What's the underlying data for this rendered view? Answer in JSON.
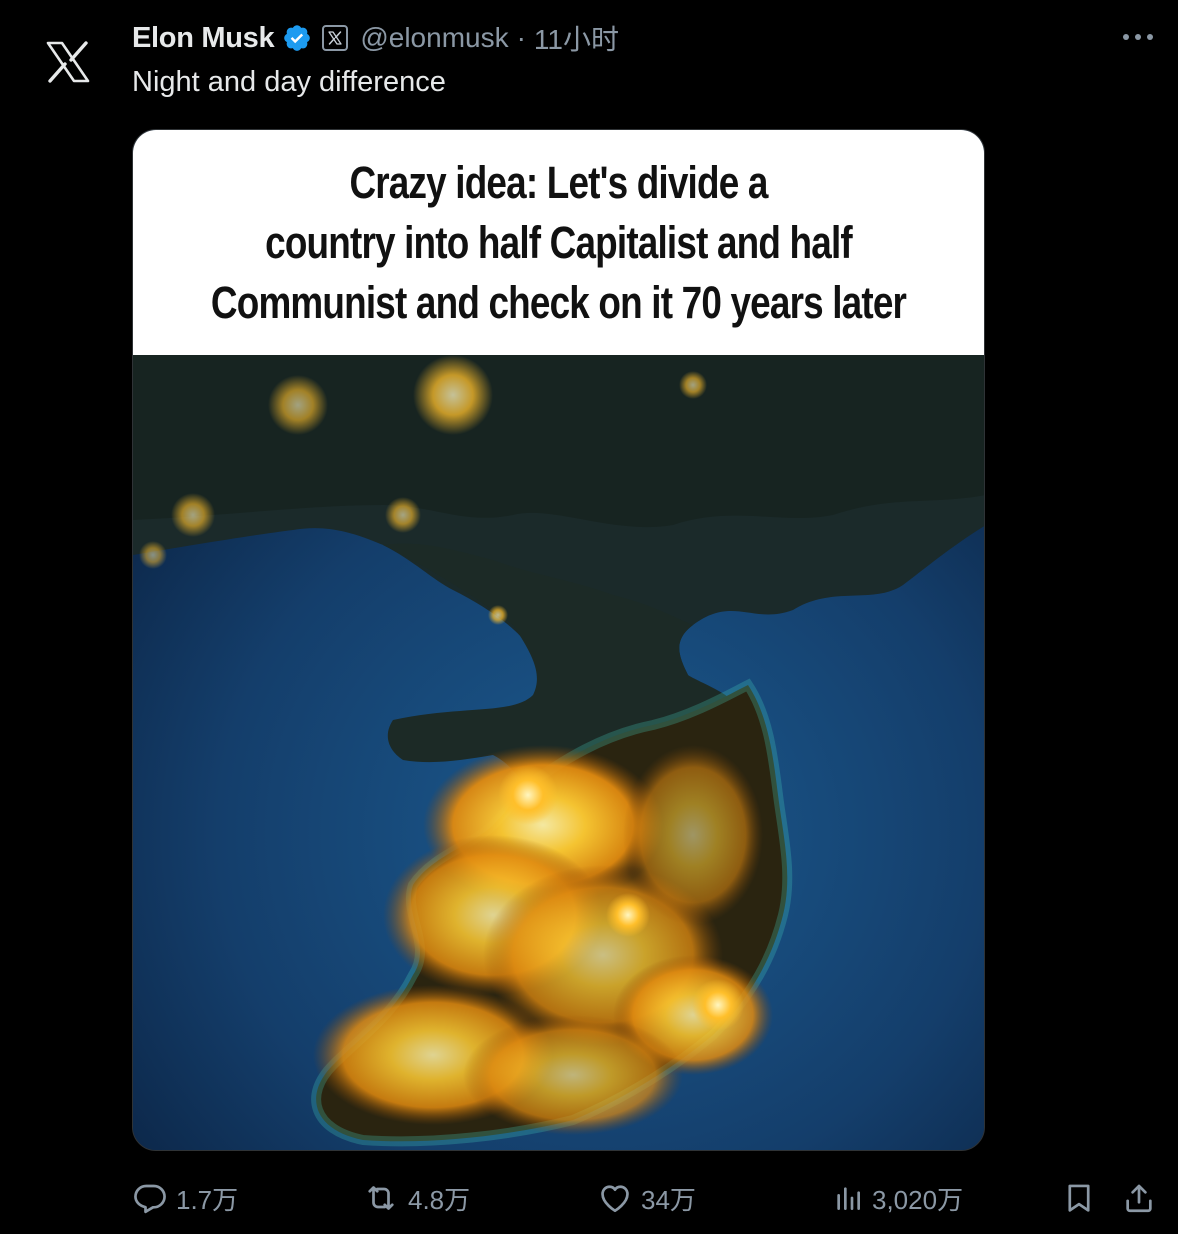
{
  "author": {
    "name": "Elon Musk",
    "handle": "@elonmusk",
    "separator": "·",
    "time": "11小时",
    "avatar_icon": "x-logo-icon",
    "verified_color": "#1d9bf0"
  },
  "tweet": {
    "text": "Night and day difference"
  },
  "media": {
    "caption": "Crazy idea:  Let's divide a\ncountry into half Capitalist and half\nCommunist and check on it 70 years later",
    "image_description_icon": "korea-night-satellite-image"
  },
  "actions": {
    "reply_count": "1.7万",
    "retweet_count": "4.8万",
    "like_count": "34万",
    "views_count": "3,020万"
  },
  "colors": {
    "background": "#000000",
    "text": "#e7e9ea",
    "secondary": "#8b98a5"
  }
}
